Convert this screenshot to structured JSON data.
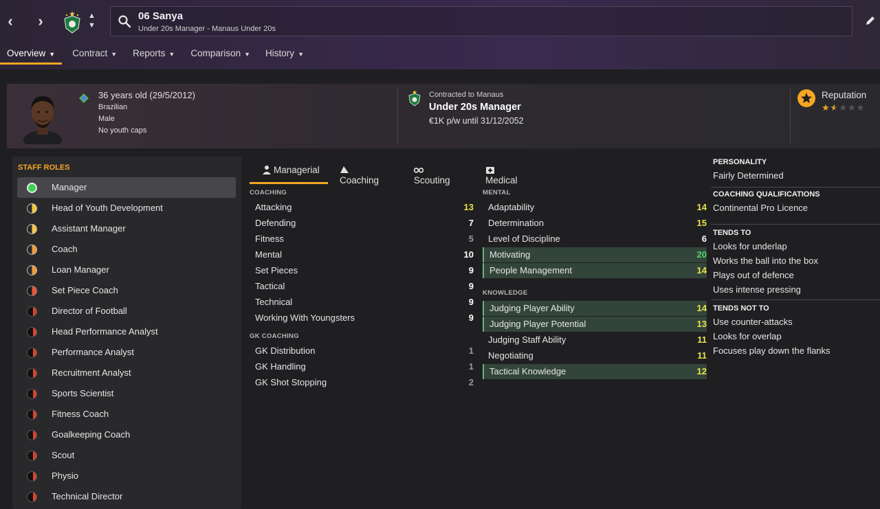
{
  "header": {
    "staff_name": "06 Sanya",
    "subtitle": "Under 20s Manager - Manaus Under 20s"
  },
  "tabs": [
    {
      "label": "Overview"
    },
    {
      "label": "Contract"
    },
    {
      "label": "Reports"
    },
    {
      "label": "Comparison"
    },
    {
      "label": "History"
    }
  ],
  "profile": {
    "age": "36 years old (29/5/2012)",
    "nationality": "Brazilian",
    "gender": "Male",
    "youth_caps": "No youth caps"
  },
  "contract": {
    "label": "Contracted to Manaus",
    "role": "Under 20s Manager",
    "wage": "€1K p/w until 31/12/2052"
  },
  "reputation": {
    "label": "Reputation",
    "stars": 1.5,
    "max_stars": 5
  },
  "staff_roles": {
    "title": "STAFF ROLES",
    "items": [
      {
        "label": "Manager",
        "selected": true,
        "suitability": "green"
      },
      {
        "label": "Head of Youth Development",
        "suitability": "yellow"
      },
      {
        "label": "Assistant Manager",
        "suitability": "yellow"
      },
      {
        "label": "Coach",
        "suitability": "orange"
      },
      {
        "label": "Loan Manager",
        "suitability": "orange"
      },
      {
        "label": "Set Piece Coach",
        "suitability": "red"
      },
      {
        "label": "Director of Football",
        "suitability": "darkred"
      },
      {
        "label": "Head Performance Analyst",
        "suitability": "darkred"
      },
      {
        "label": "Performance Analyst",
        "suitability": "darkred"
      },
      {
        "label": "Recruitment Analyst",
        "suitability": "darkred"
      },
      {
        "label": "Sports Scientist",
        "suitability": "darkred"
      },
      {
        "label": "Fitness Coach",
        "suitability": "darkred"
      },
      {
        "label": "Goalkeeping Coach",
        "suitability": "darkred"
      },
      {
        "label": "Scout",
        "suitability": "darkred"
      },
      {
        "label": "Physio",
        "suitability": "darkred"
      },
      {
        "label": "Technical Director",
        "suitability": "darkred"
      }
    ]
  },
  "attr_tabs": [
    {
      "label": "Managerial"
    },
    {
      "label": "Coaching"
    },
    {
      "label": "Scouting"
    },
    {
      "label": "Medical"
    }
  ],
  "coaching": {
    "title": "COACHING",
    "items": [
      {
        "name": "Attacking",
        "value": "13"
      },
      {
        "name": "Defending",
        "value": "7"
      },
      {
        "name": "Fitness",
        "value": "5"
      },
      {
        "name": "Mental",
        "value": "10"
      },
      {
        "name": "Set Pieces",
        "value": "9"
      },
      {
        "name": "Tactical",
        "value": "9"
      },
      {
        "name": "Technical",
        "value": "9"
      },
      {
        "name": "Working With Youngsters",
        "value": "9"
      }
    ]
  },
  "gk_coaching": {
    "title": "GK COACHING",
    "items": [
      {
        "name": "GK Distribution",
        "value": "1"
      },
      {
        "name": "GK Handling",
        "value": "1"
      },
      {
        "name": "GK Shot Stopping",
        "value": "2"
      }
    ]
  },
  "mental": {
    "title": "MENTAL",
    "items": [
      {
        "name": "Adaptability",
        "value": "14"
      },
      {
        "name": "Determination",
        "value": "15"
      },
      {
        "name": "Level of Discipline",
        "value": "6"
      },
      {
        "name": "Motivating",
        "value": "20",
        "highlight": true
      },
      {
        "name": "People Management",
        "value": "14",
        "highlight": true
      }
    ]
  },
  "knowledge": {
    "title": "KNOWLEDGE",
    "items": [
      {
        "name": "Judging Player Ability",
        "value": "14",
        "highlight": true
      },
      {
        "name": "Judging Player Potential",
        "value": "13",
        "highlight": true
      },
      {
        "name": "Judging Staff Ability",
        "value": "11"
      },
      {
        "name": "Negotiating",
        "value": "11"
      },
      {
        "name": "Tactical Knowledge",
        "value": "12",
        "highlight": true
      }
    ]
  },
  "personality": {
    "title": "PERSONALITY",
    "value": "Fairly Determined"
  },
  "coaching_qualifications": {
    "title": "COACHING QUALIFICATIONS",
    "value": "Continental Pro Licence"
  },
  "tends_to": {
    "title": "TENDS TO",
    "items": [
      "Looks for underlap",
      "Works the ball into the box",
      "Plays out of defence",
      "Uses intense pressing"
    ]
  },
  "tends_not_to": {
    "title": "TENDS NOT TO",
    "items": [
      "Use counter-attacks",
      "Looks for overlap",
      "Focuses play down the flanks"
    ]
  },
  "colors": {
    "accent": "#f5a623",
    "value_white": "#ffffff",
    "value_yellow": "#e8e24a",
    "value_green": "#4cd964",
    "value_grey": "#9a9a9a",
    "highlight_row": "#33453a"
  }
}
